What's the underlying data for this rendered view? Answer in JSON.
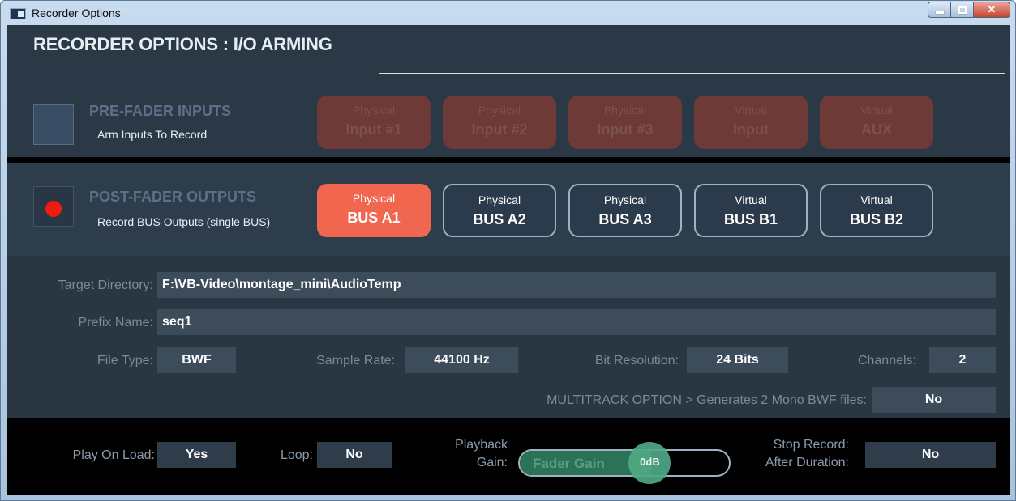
{
  "window": {
    "title": "Recorder Options"
  },
  "heading": "RECORDER OPTIONS : I/O ARMING",
  "pre_fader": {
    "title": "PRE-FADER INPUTS",
    "subtitle": "Arm Inputs To Record",
    "armed": false,
    "inputs": [
      {
        "line1": "Physical",
        "line2": "Input #1"
      },
      {
        "line1": "Physical",
        "line2": "Input #2"
      },
      {
        "line1": "Physical",
        "line2": "Input #3"
      },
      {
        "line1": "Virtual",
        "line2": "Input"
      },
      {
        "line1": "Virtual",
        "line2": "AUX"
      }
    ]
  },
  "post_fader": {
    "title": "POST-FADER OUTPUTS",
    "subtitle": "Record BUS Outputs (single BUS)",
    "armed": true,
    "buses": [
      {
        "line1": "Physical",
        "line2": "BUS A1",
        "selected": true
      },
      {
        "line1": "Physical",
        "line2": "BUS A2",
        "selected": false
      },
      {
        "line1": "Physical",
        "line2": "BUS A3",
        "selected": false
      },
      {
        "line1": "Virtual",
        "line2": "BUS B1",
        "selected": false
      },
      {
        "line1": "Virtual",
        "line2": "BUS B2",
        "selected": false
      }
    ]
  },
  "settings": {
    "target_directory": {
      "label": "Target Directory:",
      "value": "F:\\VB-Video\\montage_mini\\AudioTemp"
    },
    "prefix_name": {
      "label": "Prefix Name:",
      "value": "seq1"
    },
    "file_type": {
      "label": "File Type:",
      "value": "BWF"
    },
    "sample_rate": {
      "label": "Sample Rate:",
      "value": "44100 Hz"
    },
    "bit_resolution": {
      "label": "Bit Resolution:",
      "value": "24 Bits"
    },
    "channels": {
      "label": "Channels:",
      "value": "2"
    },
    "multitrack": {
      "label": "MULTITRACK OPTION > Generates 2 Mono BWF files:",
      "value": "No"
    }
  },
  "playback": {
    "play_on_load": {
      "label": "Play On Load:",
      "value": "Yes"
    },
    "loop": {
      "label": "Loop:",
      "value": "No"
    },
    "gain": {
      "label_line1": "Playback",
      "label_line2": "Gain:",
      "fader_label": "Fader Gain",
      "value_text": "0dB",
      "level_fraction": 0.62
    },
    "stop_record": {
      "label_line1": "Stop Record:",
      "label_line2": "After Duration:",
      "value": "No"
    }
  },
  "colors": {
    "record_dot": "#ee1b0e",
    "selected_bus": "#f0664e",
    "disabled_input": "#6d3a38",
    "fader_green": "#4fa985"
  }
}
